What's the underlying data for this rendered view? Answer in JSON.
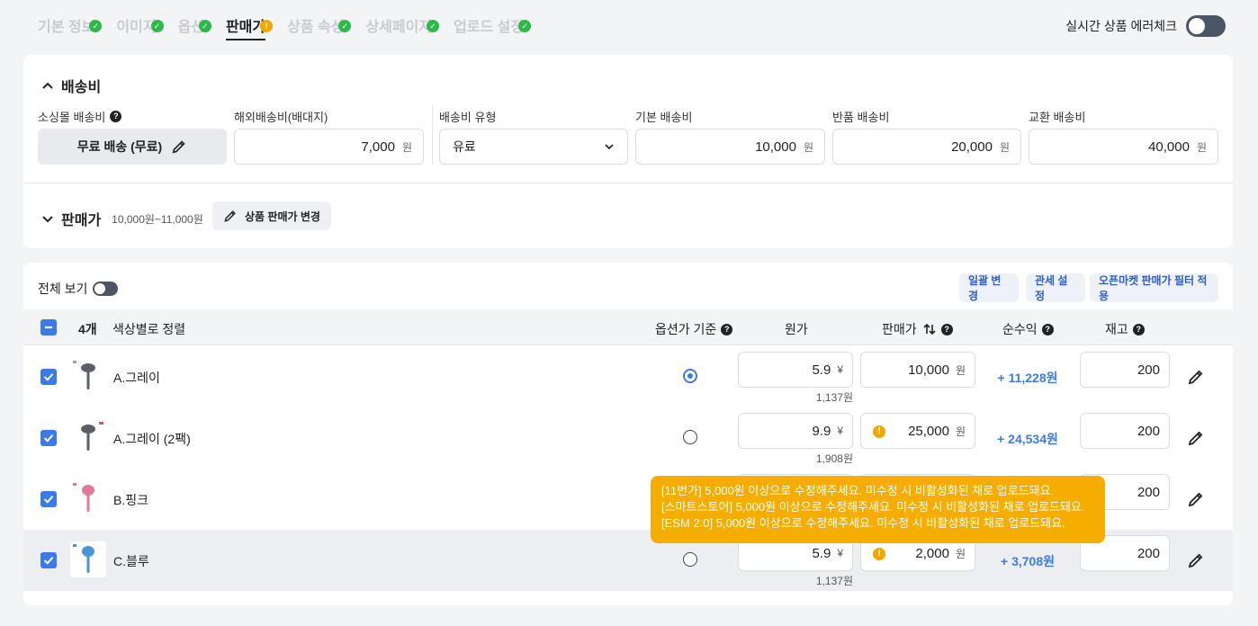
{
  "tabs": [
    {
      "label": "기본 정보",
      "status": "ok"
    },
    {
      "label": "이미지",
      "status": "ok"
    },
    {
      "label": "옵션",
      "status": "ok"
    },
    {
      "label": "판매가",
      "status": "warn"
    },
    {
      "label": "상품 속성",
      "status": "ok"
    },
    {
      "label": "상세페이지",
      "status": "ok"
    },
    {
      "label": "업로드 설정",
      "status": "ok"
    }
  ],
  "realtime_check": {
    "label": "실시간 상품 에러체크",
    "enabled": false
  },
  "shipping": {
    "title": "배송비",
    "small_label": "소싱몰 배송비",
    "small_value": "무료 배송 (무료)",
    "overseas_label": "해외배송비(배대지)",
    "overseas_value": "7,000",
    "type_label": "배송비 유형",
    "type_value": "유료",
    "base_label": "기본 배송비",
    "base_value": "10,000",
    "return_label": "반품 배송비",
    "return_value": "20,000",
    "exchange_label": "교환 배송비",
    "exchange_value": "40,000",
    "unit": "원"
  },
  "price": {
    "title": "판매가",
    "range": "10,000원~11,000원",
    "change_button": "상품 판매가 변경"
  },
  "options": {
    "all_view": "전체 보기",
    "bulk_button": "일괄 변경",
    "tariff_button": "관세 설정",
    "filter_button": "오픈마켓 판매가 필터 적용",
    "count": "4개",
    "sort_label": "색상별로 정렬",
    "col_basis": "옵션가 기준",
    "col_cost": "원가",
    "col_price": "판매가",
    "col_profit": "순수익",
    "col_stock": "재고",
    "rows": [
      {
        "name": "A.그레이",
        "cost": "5.9",
        "cost_unit": "¥",
        "cost_won": "1,137원",
        "price": "10,000",
        "price_unit": "원",
        "profit": "+ 11,228원",
        "stock": "200",
        "basis": true,
        "warn": false,
        "thumb_color": "#5a6066",
        "badge_color": "#9aa0a6"
      },
      {
        "name": "A.그레이 (2팩)",
        "cost": "9.9",
        "cost_unit": "¥",
        "cost_won": "1,908원",
        "price": "25,000",
        "price_unit": "원",
        "profit": "+ 24,534원",
        "stock": "200",
        "basis": false,
        "warn": true,
        "thumb_color": "#5a6066",
        "badge_color": "#e25757"
      },
      {
        "name": "B.핑크",
        "cost": "",
        "cost_unit": "",
        "cost_won": "",
        "price": "",
        "price_unit": "",
        "profit": "",
        "stock": "200",
        "basis": false,
        "warn": false,
        "thumb_color": "#e07a9b",
        "badge_color": "#e07a9b"
      },
      {
        "name": "C.블루",
        "cost": "5.9",
        "cost_unit": "¥",
        "cost_won": "1,137원",
        "price": "2,000",
        "price_unit": "원",
        "profit": "+ 3,708원",
        "stock": "200",
        "basis": false,
        "warn": true,
        "thumb_color": "#4b95d6",
        "badge_color": "#4b95d6"
      }
    ]
  },
  "tooltip": {
    "lines": [
      "[11번가] 5,000원 이상으로 수정해주세요. 미수정 시 비활성화된 채로 업로드돼요.",
      "[스마트스토어] 5,000원 이상으로 수정해주세요. 미수정 시 비활성화된 채로 업로드돼요.",
      "[ESM 2.0] 5,000원 이상으로 수정해주세요. 미수정 시 비활성화된 채로 업로드돼요."
    ]
  },
  "colors": {
    "accent": "#3b7be8",
    "warn": "#f5ad00",
    "ok": "#2fb84a"
  },
  "icons": [
    "check-icon",
    "warning-icon",
    "help-icon",
    "pencil-icon",
    "chevron-up-icon",
    "chevron-down-icon",
    "sort-icon"
  ]
}
